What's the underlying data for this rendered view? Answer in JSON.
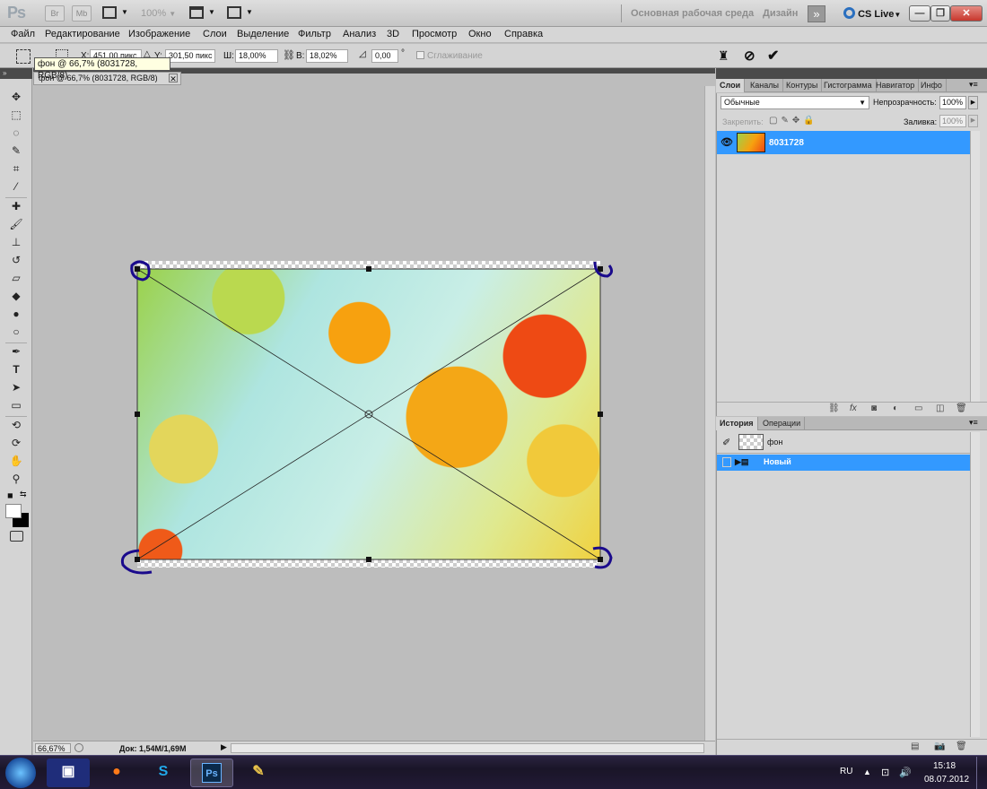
{
  "appbar": {
    "logo": "Ps",
    "br": "Br",
    "mb": "Mb",
    "zoom": "100%",
    "workspace": "Основная рабочая среда",
    "design": "Дизайн",
    "more": "»",
    "cslive": "CS Live"
  },
  "menu": [
    "Файл",
    "Редактирование",
    "Изображение",
    "Слои",
    "Выделение",
    "Фильтр",
    "Анализ",
    "3D",
    "Просмотр",
    "Окно",
    "Справка"
  ],
  "options": {
    "x_label": "X:",
    "x_value": "451,00 пикс",
    "y_label": "Y:",
    "y_value": "301,50 пикс",
    "w_label": "Ш:",
    "w_value": "18,00%",
    "h_label": "В:",
    "h_value": "18,02%",
    "angle_value": "0,00",
    "degree": "°",
    "smoothing": "Сглаживание"
  },
  "tooltip": "фон @ 66,7% (8031728, RGB/8)",
  "document": {
    "tab_title": "фон @ 66,7% (8031728, RGB/8)",
    "zoom": "66,67%",
    "doc_size": "Док: 1,54M/1,69M"
  },
  "layers_panel": {
    "tabs": [
      "Слои",
      "Каналы",
      "Контуры",
      "Гистограмма",
      "Навигатор",
      "Инфо"
    ],
    "blend_mode": "Обычные",
    "opacity_label": "Непрозрачность:",
    "opacity": "100%",
    "lock_label": "Закрепить:",
    "fill_label": "Заливка:",
    "fill": "100%",
    "layer_name": "8031728"
  },
  "history_panel": {
    "tabs": [
      "История",
      "Операции"
    ],
    "snapshot": "фон",
    "state": "Новый"
  },
  "taskbar": {
    "lang": "RU",
    "time": "15:18",
    "date": "08.07.2012"
  },
  "colors": {
    "selection": "#3399ff",
    "annotation": "#1a0a8c",
    "close_button": "#c8372d"
  }
}
